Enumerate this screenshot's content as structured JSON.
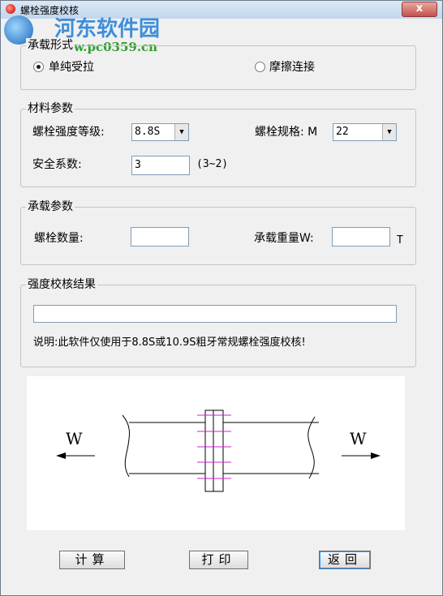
{
  "window": {
    "title": "螺栓强度校核",
    "close_label": "x"
  },
  "watermark": {
    "line1": "河东软件园",
    "line2": "www.pc0359.cn"
  },
  "load_form": {
    "legend": "承载形式",
    "options": [
      {
        "label": "单纯受拉",
        "checked": true
      },
      {
        "label": "摩擦连接",
        "checked": false
      }
    ]
  },
  "material": {
    "legend": "材料参数",
    "grade_label": "螺栓强度等级:",
    "grade_value": "8.8S",
    "spec_label": "螺栓规格: M",
    "spec_value": "22",
    "safety_label": "安全系数:",
    "safety_value": "3",
    "safety_hint": "(3~2)"
  },
  "load_params": {
    "legend": "承载参数",
    "count_label": "螺栓数量:",
    "count_value": "",
    "weight_label": "承载重量W:",
    "weight_value": "",
    "weight_unit": "T"
  },
  "result": {
    "legend": "强度校核结果",
    "value": "",
    "note": "说明:此软件仅使用于8.8S或10.9S粗牙常规螺栓强度校核!"
  },
  "diagram": {
    "left_label": "W",
    "right_label": "W"
  },
  "buttons": {
    "calc": "计算",
    "print": "打印",
    "back": "返回"
  }
}
